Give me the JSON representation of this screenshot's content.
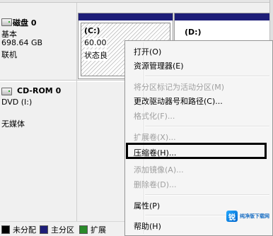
{
  "disk0": {
    "title": "磁盘 0",
    "type": "基本",
    "size": "698.64 GB",
    "status": "联机"
  },
  "cdrom": {
    "title": "CD-ROM 0",
    "drive": "DVD (I:)",
    "media": "无媒体"
  },
  "partitions": {
    "c": {
      "name": "(C:)",
      "size": "60.00",
      "status": "状态良"
    },
    "d": {
      "name": "(D:)"
    }
  },
  "context_menu": {
    "items": [
      {
        "label": "打开(O)",
        "enabled": true
      },
      {
        "label": "资源管理器(E)",
        "enabled": true
      },
      {
        "label": "将分区标记为活动分区(M)",
        "enabled": false
      },
      {
        "label": "更改驱动器号和路径(C)...",
        "enabled": true
      },
      {
        "label": "格式化(F)...",
        "enabled": false
      },
      {
        "label": "扩展卷(X)...",
        "enabled": false
      },
      {
        "label": "压缩卷(H)...",
        "enabled": true
      },
      {
        "label": "添加镜像(A)...",
        "enabled": false
      },
      {
        "label": "删除卷(D)...",
        "enabled": false
      },
      {
        "label": "属性(P)",
        "enabled": true
      },
      {
        "label": "帮助(H)",
        "enabled": true
      }
    ],
    "highlighted": "压缩卷(H)..."
  },
  "legend": {
    "items": [
      {
        "label": "未分配",
        "color": "#000000"
      },
      {
        "label": "主分区",
        "color": "#1e1e78"
      },
      {
        "label": "扩展",
        "color": "#2a8a2a"
      }
    ]
  },
  "watermark": {
    "logo_text": "锐",
    "text": "纯净版下载网"
  },
  "colors": {
    "primary_partition": "#1e1e78",
    "menu_bg": "#f5f5f5",
    "highlight_border": "#000000"
  }
}
